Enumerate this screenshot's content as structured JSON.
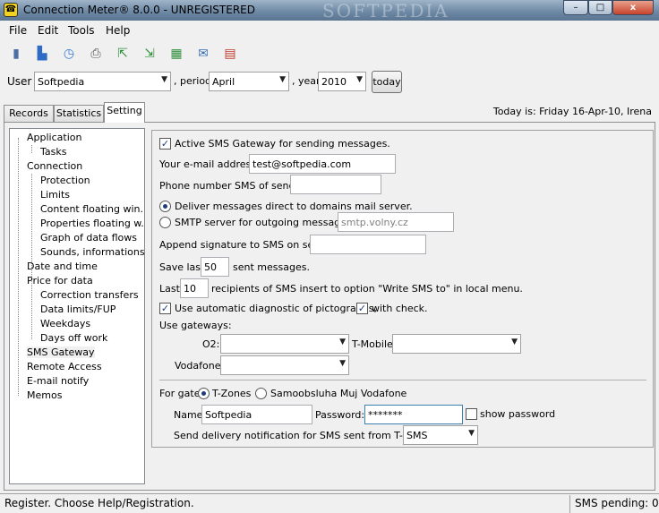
{
  "window": {
    "title": "Connection Meter® 8.0.0 - UNREGISTERED",
    "watermark": "SOFTPEDIA",
    "minimize": "–",
    "maximize": "□",
    "close": "x"
  },
  "menu": [
    "File",
    "Edit",
    "Tools",
    "Help"
  ],
  "toolbar_icons": [
    "phone-icon",
    "bar-chart-icon",
    "clock-icon",
    "printer-icon",
    "export-icon",
    "import-icon",
    "grid-icon",
    "mail-icon",
    "calendar-icon"
  ],
  "filter": {
    "user_label": "User",
    "user_value": "Softpedia",
    "period_label": ", period",
    "period_value": "April",
    "year_label": ", year",
    "year_value": "2010",
    "today_button": "today"
  },
  "tabs": [
    "Records",
    "Statistics",
    "Setting"
  ],
  "active_tab": "Setting",
  "today_text": "Today is: Friday 16-Apr-10, Irena",
  "tree": {
    "items": [
      {
        "label": "Application",
        "level": 0
      },
      {
        "label": "Tasks",
        "level": 1
      },
      {
        "label": "Connection",
        "level": 0
      },
      {
        "label": "Protection",
        "level": 1
      },
      {
        "label": "Limits",
        "level": 1
      },
      {
        "label": "Content floating win.",
        "level": 1
      },
      {
        "label": "Properties floating w.",
        "level": 1
      },
      {
        "label": "Graph of data flows",
        "level": 1
      },
      {
        "label": "Sounds, informations",
        "level": 1
      },
      {
        "label": "Date and time",
        "level": 0
      },
      {
        "label": "Price for data",
        "level": 0
      },
      {
        "label": "Correction transfers",
        "level": 1
      },
      {
        "label": "Data limits/FUP",
        "level": 1
      },
      {
        "label": "Weekdays",
        "level": 1
      },
      {
        "label": "Days off work",
        "level": 1
      },
      {
        "label": "SMS Gateway",
        "level": 0
      },
      {
        "label": "Remote Access",
        "level": 0
      },
      {
        "label": "E-mail notify",
        "level": 0
      },
      {
        "label": "Memos",
        "level": 0
      }
    ],
    "selected": "SMS Gateway"
  },
  "sms": {
    "active_label": "Active SMS Gateway for sending messages.",
    "active_checked": true,
    "email_label": "Your e-mail address",
    "email_value": "test@softpedia.com",
    "phone_label": "Phone number SMS of sender",
    "phone_value": "",
    "deliver_label": "Deliver messages direct to domains mail server.",
    "smtp_label": "SMTP server for outgoing messages",
    "smtp_placeholder": "smtp.volny.cz",
    "signature_label": "Append signature to SMS on send",
    "signature_value": "",
    "save_last_label": "Save last",
    "save_last_value": "50",
    "save_last_suffix": "sent messages.",
    "last_label": "Last",
    "last_value": "10",
    "last_suffix": "recipients of SMS insert to option \"Write SMS to\" in local menu.",
    "auto_diag_label": "Use automatic diagnostic of pictographs,",
    "auto_diag_checked": true,
    "with_check_label": "with check.",
    "with_check_checked": true,
    "use_gateways_label": "Use gateways:",
    "o2_label": "O2:",
    "o2_value": "",
    "tmobile_label": "T-Mobile:",
    "tmobile_value": "",
    "vodafone_label": "Vodafone:",
    "vodafone_value": "",
    "for_gate_label": "For gate",
    "gate_tzones": "T-Zones",
    "gate_vodafone": "Samoobsluha Muj Vodafone",
    "name_label": "Name:",
    "name_value": "Softpedia",
    "password_label": "Password:",
    "password_value": "*******",
    "show_password_label": "show password",
    "show_password_checked": false,
    "delivery_label": "Send delivery notification for SMS sent from T-Zones",
    "delivery_value": "SMS"
  },
  "status": {
    "left": "Register. Choose Help/Registration.",
    "right": "SMS pending: 0"
  }
}
